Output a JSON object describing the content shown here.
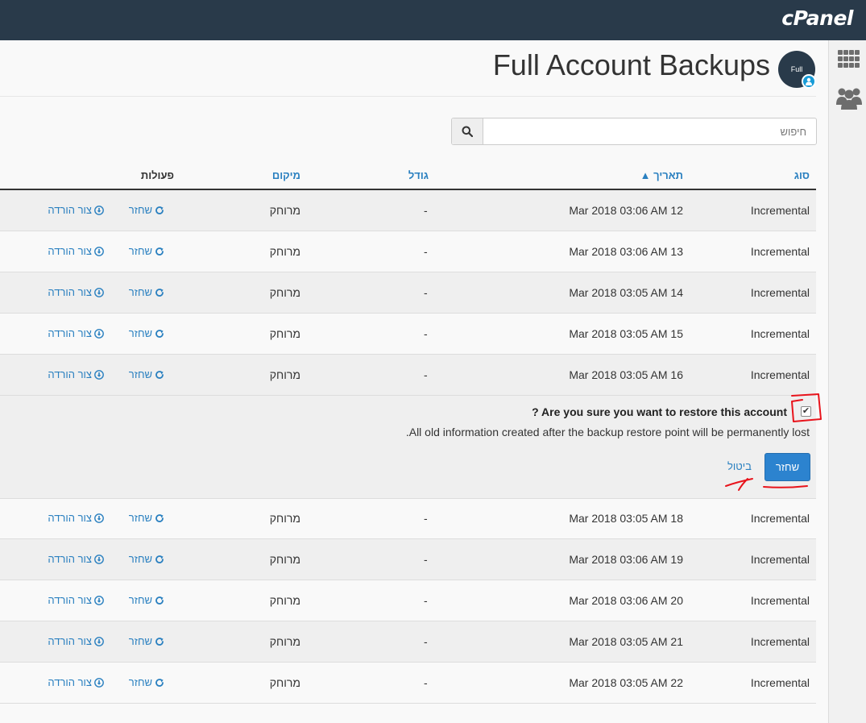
{
  "brand": "cPanel",
  "page": {
    "title": "Full Account Backups",
    "avatar_label": "Full"
  },
  "search": {
    "placeholder": "חיפוש"
  },
  "table": {
    "headers": {
      "type": "סוג",
      "date": "תאריך ▲",
      "size": "גודל",
      "location": "מיקום",
      "actions": "פעולות"
    },
    "rows": [
      {
        "type": "Incremental",
        "date": "Mar 2018 03:06 AM 12",
        "size": "-",
        "location": "מרוחק",
        "restore": "שחזר",
        "download": "צור הורדה"
      },
      {
        "type": "Incremental",
        "date": "Mar 2018 03:06 AM 13",
        "size": "-",
        "location": "מרוחק",
        "restore": "שחזר",
        "download": "צור הורדה"
      },
      {
        "type": "Incremental",
        "date": "Mar 2018 03:05 AM 14",
        "size": "-",
        "location": "מרוחק",
        "restore": "שחזר",
        "download": "צור הורדה"
      },
      {
        "type": "Incremental",
        "date": "Mar 2018 03:05 AM 15",
        "size": "-",
        "location": "מרוחק",
        "restore": "שחזר",
        "download": "צור הורדה"
      },
      {
        "type": "Incremental",
        "date": "Mar 2018 03:05 AM 16",
        "size": "-",
        "location": "מרוחק",
        "restore": "שחזר",
        "download": "צור הורדה"
      },
      {
        "type": "Incremental",
        "date": "Mar 2018 03:05 AM 18",
        "size": "-",
        "location": "מרוחק",
        "restore": "שחזר",
        "download": "צור הורדה"
      },
      {
        "type": "Incremental",
        "date": "Mar 2018 03:06 AM 19",
        "size": "-",
        "location": "מרוחק",
        "restore": "שחזר",
        "download": "צור הורדה"
      },
      {
        "type": "Incremental",
        "date": "Mar 2018 03:06 AM 20",
        "size": "-",
        "location": "מרוחק",
        "restore": "שחזר",
        "download": "צור הורדה"
      },
      {
        "type": "Incremental",
        "date": "Mar 2018 03:05 AM 21",
        "size": "-",
        "location": "מרוחק",
        "restore": "שחזר",
        "download": "צור הורדה"
      },
      {
        "type": "Incremental",
        "date": "Mar 2018 03:05 AM 22",
        "size": "-",
        "location": "מרוחק",
        "restore": "שחזר",
        "download": "צור הורדה"
      }
    ]
  },
  "confirm": {
    "question": "? Are you sure you want to restore this account",
    "checked": true,
    "message": ".All old information created after the backup restore point will be permanently lost",
    "restore_button": "שחזר",
    "cancel_link": "ביטול"
  },
  "colors": {
    "topbar": "#293a4a",
    "link": "#2a80c0",
    "primary_button": "#2c83cf",
    "annotation": "#e8141c"
  },
  "icons": {
    "search": "search-icon",
    "restore": "refresh-icon",
    "download": "download-circle-icon",
    "apps": "grid-icon",
    "users": "users-icon"
  }
}
